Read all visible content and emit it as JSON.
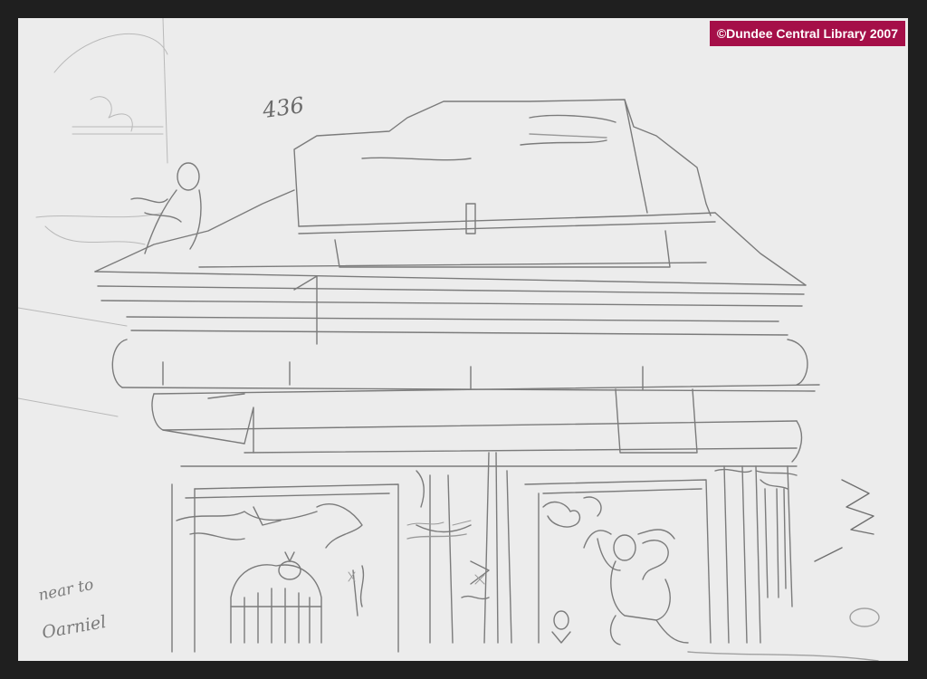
{
  "watermark": {
    "text": "©Dundee Central Library 2007",
    "background": "#a50f48",
    "color": "#ffffff"
  },
  "sketch": {
    "sheet_number": "436",
    "margin_note": [
      "near to",
      "Oarniel"
    ],
    "medium": "pencil",
    "paper_color": "#ececec",
    "frame_color": "#1f1f1f"
  }
}
